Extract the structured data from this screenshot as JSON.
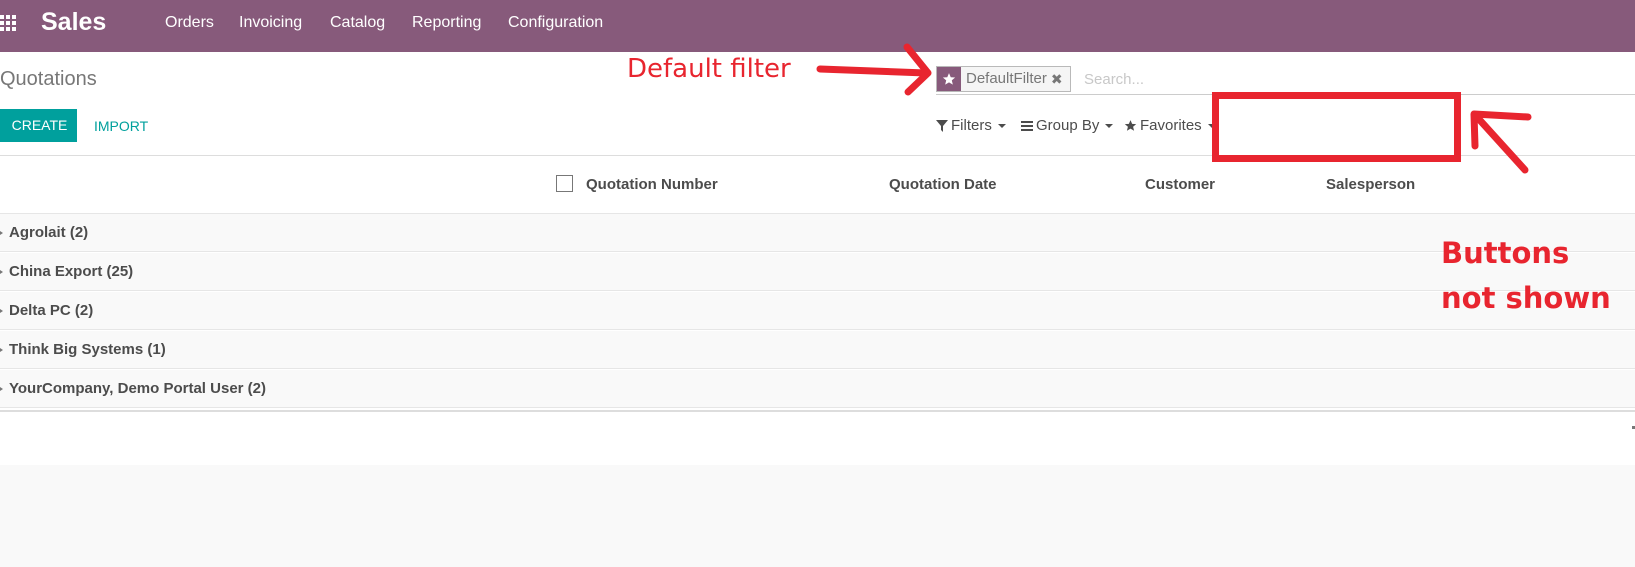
{
  "navbar": {
    "apps_icon": "grid-icon",
    "brand": "Sales",
    "menu": [
      "Orders",
      "Invoicing",
      "Catalog",
      "Reporting",
      "Configuration"
    ]
  },
  "breadcrumb": "Quotations",
  "buttons": {
    "create": "CREATE",
    "import": "IMPORT"
  },
  "search": {
    "facet_icon": "star-icon",
    "facet_value": "DefaultFilter",
    "facet_remove_icon": "close-icon",
    "placeholder": "Search..."
  },
  "search_options": [
    {
      "icon": "filter-icon",
      "label": "Filters"
    },
    {
      "icon": "list-icon",
      "label": "Group By"
    },
    {
      "icon": "star-icon",
      "label": "Favorites"
    }
  ],
  "table": {
    "columns": [
      "Quotation Number",
      "Quotation Date",
      "Customer",
      "Salesperson"
    ],
    "groups": [
      "Agrolait (2)",
      "China Export (25)",
      "Delta PC (2)",
      "Think Big Systems (1)",
      "YourCompany, Demo Portal User (2)"
    ]
  },
  "annotations": {
    "default_filter": "Default filter",
    "buttons_line1": "Buttons",
    "buttons_line2": "not shown",
    "color": "#e8252f"
  },
  "colors": {
    "brand": "#875a7b",
    "accent": "#00a09d"
  }
}
